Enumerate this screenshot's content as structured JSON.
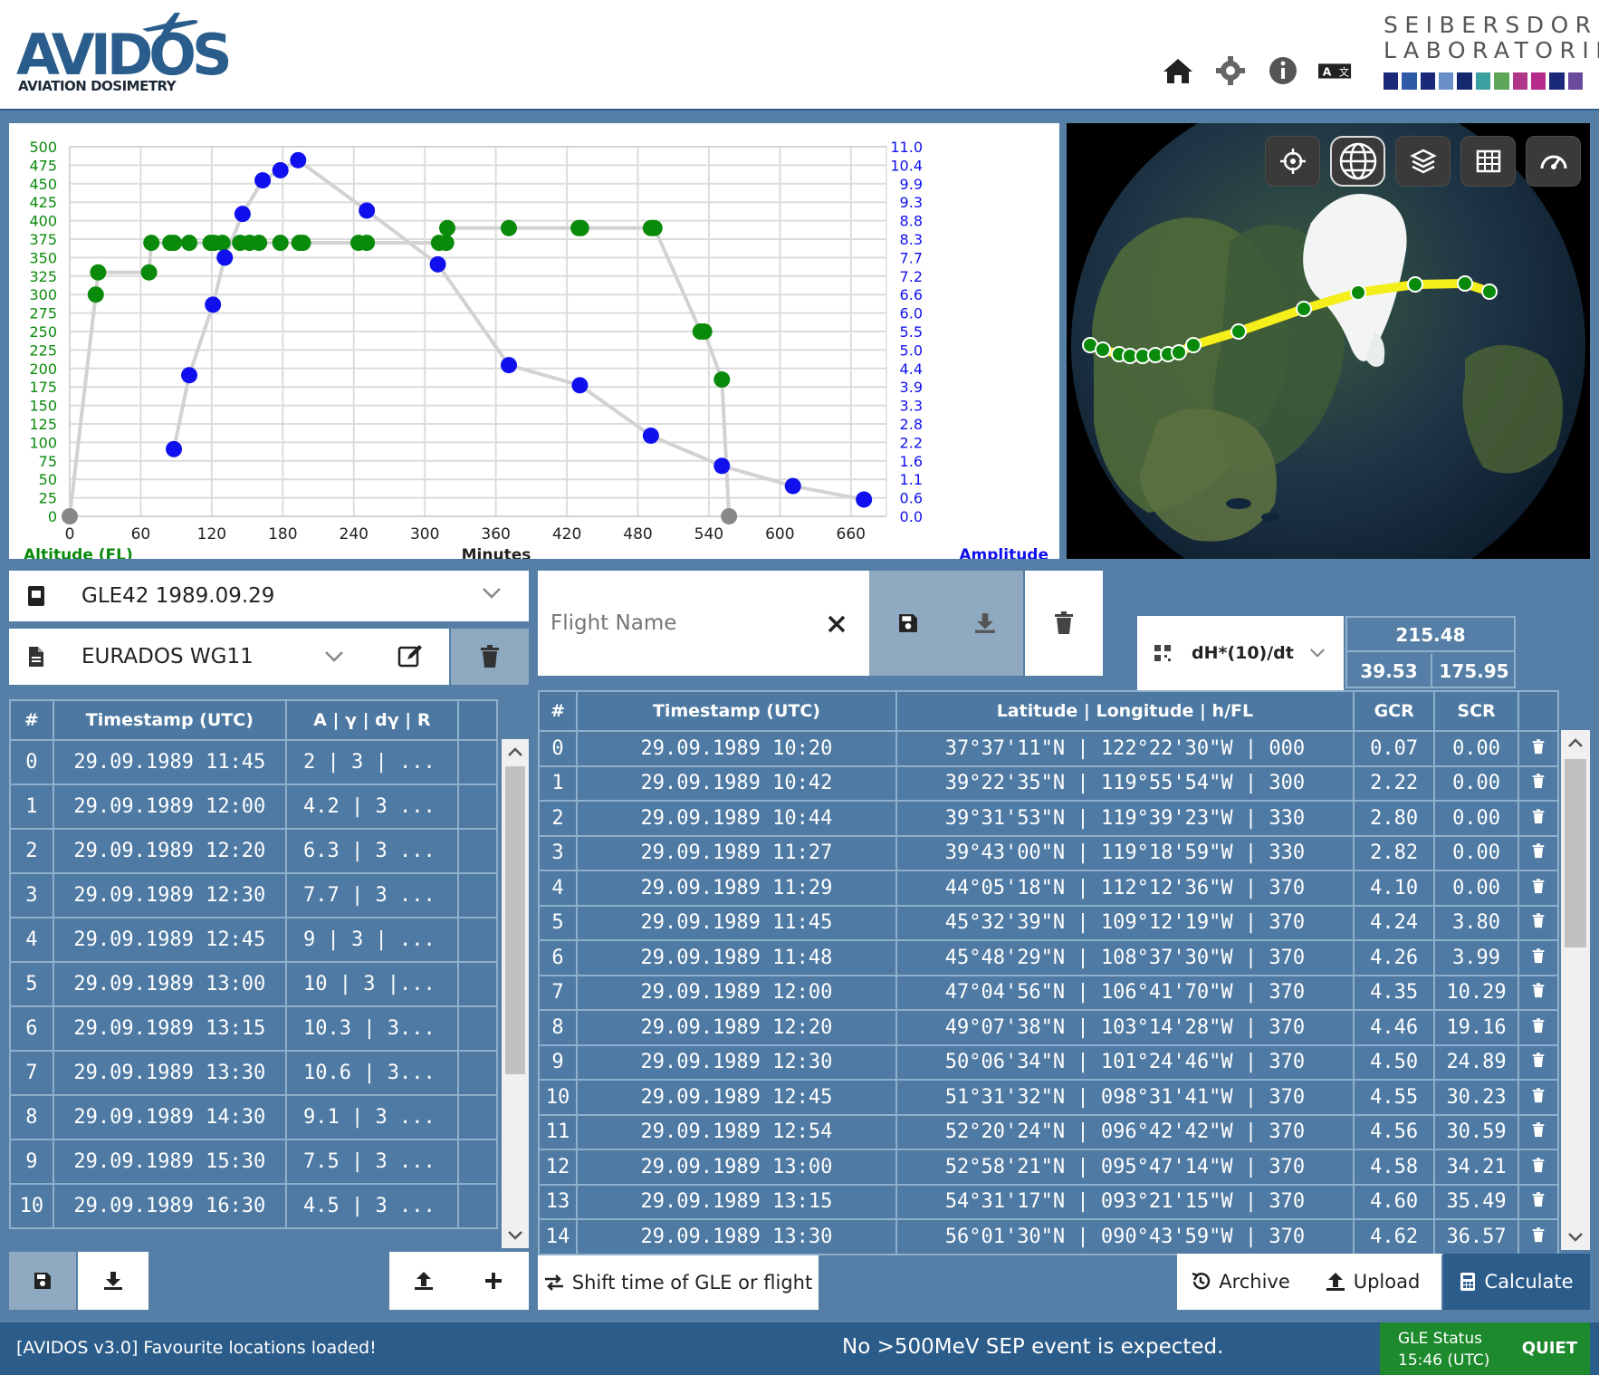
{
  "app": {
    "logo_text": "AVIDOS",
    "logo_sub": "AVIATION DOSIMETRY",
    "org_line1": "SEIBERSDORF",
    "org_line2": "LABORATORIES",
    "org_colors": [
      "#1b2a78",
      "#2e5aa8",
      "#1b2a78",
      "#6a8fc8",
      "#14286e",
      "#3aa0a0",
      "#5da65a",
      "#b0368a",
      "#b62a8a",
      "#1b2a78",
      "#6a4a9a"
    ]
  },
  "header_icons": [
    "home-icon",
    "settings-icon",
    "info-icon",
    "language-icon"
  ],
  "chart_data": {
    "type": "line",
    "xlabel": "Minutes",
    "ylabel_left": "Altitude (FL)",
    "ylabel_right": "Amplitude",
    "xlim": [
      0,
      690
    ],
    "x_ticks": [
      0,
      60,
      120,
      180,
      240,
      300,
      360,
      420,
      480,
      540,
      600,
      660
    ],
    "ylim_left": [
      0,
      500
    ],
    "y_ticks_left": [
      0,
      25,
      50,
      75,
      100,
      125,
      150,
      175,
      200,
      225,
      250,
      275,
      300,
      325,
      350,
      375,
      400,
      425,
      450,
      475,
      500
    ],
    "y_ticks_right": [
      "0.0",
      "0.6",
      "1.1",
      "1.6",
      "2.2",
      "2.8",
      "3.3",
      "3.9",
      "4.4",
      "5.0",
      "5.5",
      "6.0",
      "6.6",
      "7.2",
      "7.7",
      "8.3",
      "8.8",
      "9.3",
      "9.9",
      "10.4",
      "11.0"
    ],
    "grid": true,
    "series": [
      {
        "name": "Altitude (FL)",
        "color": "#0a8a0a",
        "points": [
          [
            0,
            0
          ],
          [
            22,
            300
          ],
          [
            24,
            330
          ],
          [
            67,
            330
          ],
          [
            69,
            370
          ],
          [
            85,
            370
          ],
          [
            88,
            370
          ],
          [
            101,
            370
          ],
          [
            119,
            370
          ],
          [
            122,
            370
          ],
          [
            129,
            370
          ],
          [
            144,
            370
          ],
          [
            152,
            370
          ],
          [
            160,
            370
          ],
          [
            178,
            370
          ],
          [
            194,
            370
          ],
          [
            197,
            370
          ],
          [
            244,
            370
          ],
          [
            251,
            370
          ],
          [
            312,
            370
          ],
          [
            318,
            370
          ],
          [
            319,
            390
          ],
          [
            371,
            390
          ],
          [
            430,
            390
          ],
          [
            432,
            390
          ],
          [
            491,
            390
          ],
          [
            494,
            390
          ],
          [
            533,
            250
          ],
          [
            536,
            250
          ],
          [
            551,
            185
          ],
          [
            557,
            0
          ]
        ]
      },
      {
        "name": "Amplitude",
        "color": "#1010ee",
        "points": [
          [
            88,
            2
          ],
          [
            101,
            4.2
          ],
          [
            121,
            6.3
          ],
          [
            131,
            7.7
          ],
          [
            146,
            9
          ],
          [
            163,
            10
          ],
          [
            178,
            10.3
          ],
          [
            193,
            10.6
          ],
          [
            251,
            9.1
          ],
          [
            311,
            7.5
          ],
          [
            371,
            4.5
          ],
          [
            431,
            3.9
          ],
          [
            491,
            2.4
          ],
          [
            551,
            1.5
          ],
          [
            611,
            0.9
          ],
          [
            671,
            0.5
          ]
        ]
      }
    ]
  },
  "map": {
    "buttons": [
      "locate-icon",
      "globe-icon",
      "layers-icon",
      "grid-icon",
      "gauge-icon"
    ]
  },
  "event_select": {
    "value": "GLE42 1989.09.29"
  },
  "model_select": {
    "value": "EURADOS WG11"
  },
  "gle_table": {
    "headers": [
      "#",
      "Timestamp (UTC)",
      "A | γ | dγ | R"
    ],
    "rows": [
      [
        "0",
        "29.09.1989 11:45",
        "2 | 3 | ..."
      ],
      [
        "1",
        "29.09.1989 12:00",
        "4.2 | 3 ..."
      ],
      [
        "2",
        "29.09.1989 12:20",
        "6.3 | 3 ..."
      ],
      [
        "3",
        "29.09.1989 12:30",
        "7.7 | 3 ..."
      ],
      [
        "4",
        "29.09.1989 12:45",
        "9 | 3 | ..."
      ],
      [
        "5",
        "29.09.1989 13:00",
        "10 | 3 |..."
      ],
      [
        "6",
        "29.09.1989 13:15",
        "10.3 | 3..."
      ],
      [
        "7",
        "29.09.1989 13:30",
        "10.6 | 3..."
      ],
      [
        "8",
        "29.09.1989 14:30",
        "9.1 | 3 ..."
      ],
      [
        "9",
        "29.09.1989 15:30",
        "7.5 | 3 ..."
      ],
      [
        "10",
        "29.09.1989 16:30",
        "4.5 | 3 ..."
      ]
    ]
  },
  "flight": {
    "name_placeholder": "Flight Name",
    "quantity_select": "dH*(10)/dt",
    "total_top": "215.48",
    "total_gcr": "39.53",
    "total_scr": "175.95"
  },
  "flight_table": {
    "headers": [
      "#",
      "Timestamp (UTC)",
      "Latitude | Longitude | h/FL",
      "GCR",
      "SCR"
    ],
    "rows": [
      [
        "0",
        "29.09.1989 10:20",
        "37°37'11\"N | 122°22'30\"W | 000",
        "0.07",
        "0.00"
      ],
      [
        "1",
        "29.09.1989 10:42",
        "39°22'35\"N | 119°55'54\"W | 300",
        "2.22",
        "0.00"
      ],
      [
        "2",
        "29.09.1989 10:44",
        "39°31'53\"N | 119°39'23\"W | 330",
        "2.80",
        "0.00"
      ],
      [
        "3",
        "29.09.1989 11:27",
        "39°43'00\"N | 119°18'59\"W | 330",
        "2.82",
        "0.00"
      ],
      [
        "4",
        "29.09.1989 11:29",
        "44°05'18\"N | 112°12'36\"W | 370",
        "4.10",
        "0.00"
      ],
      [
        "5",
        "29.09.1989 11:45",
        "45°32'39\"N | 109°12'19\"W | 370",
        "4.24",
        "3.80"
      ],
      [
        "6",
        "29.09.1989 11:48",
        "45°48'29\"N | 108°37'30\"W | 370",
        "4.26",
        "3.99"
      ],
      [
        "7",
        "29.09.1989 12:00",
        "47°04'56\"N | 106°41'70\"W | 370",
        "4.35",
        "10.29"
      ],
      [
        "8",
        "29.09.1989 12:20",
        "49°07'38\"N | 103°14'28\"W | 370",
        "4.46",
        "19.16"
      ],
      [
        "9",
        "29.09.1989 12:30",
        "50°06'34\"N | 101°24'46\"W | 370",
        "4.50",
        "24.89"
      ],
      [
        "10",
        "29.09.1989 12:45",
        "51°31'32\"N | 098°31'41\"W | 370",
        "4.55",
        "30.23"
      ],
      [
        "11",
        "29.09.1989 12:54",
        "52°20'24\"N | 096°42'42\"W | 370",
        "4.56",
        "30.59"
      ],
      [
        "12",
        "29.09.1989 13:00",
        "52°58'21\"N | 095°47'14\"W | 370",
        "4.58",
        "34.21"
      ],
      [
        "13",
        "29.09.1989 13:15",
        "54°31'17\"N | 093°21'15\"W | 370",
        "4.60",
        "35.49"
      ],
      [
        "14",
        "29.09.1989 13:30",
        "56°01'30\"N | 090°43'59\"W | 370",
        "4.62",
        "36.57"
      ]
    ]
  },
  "buttons": {
    "shift": "Shift time of GLE or flight",
    "archive": "Archive",
    "upload": "Upload",
    "calculate": "Calculate"
  },
  "footer": {
    "message": "[AVIDOS v3.0] Favourite locations loaded!",
    "center": "No >500MeV SEP event is expected.",
    "gle_label": "GLE Status",
    "gle_time": "15:46 (UTC)",
    "gle_value": "QUIET",
    "gle_color": "#1e8a2e"
  }
}
